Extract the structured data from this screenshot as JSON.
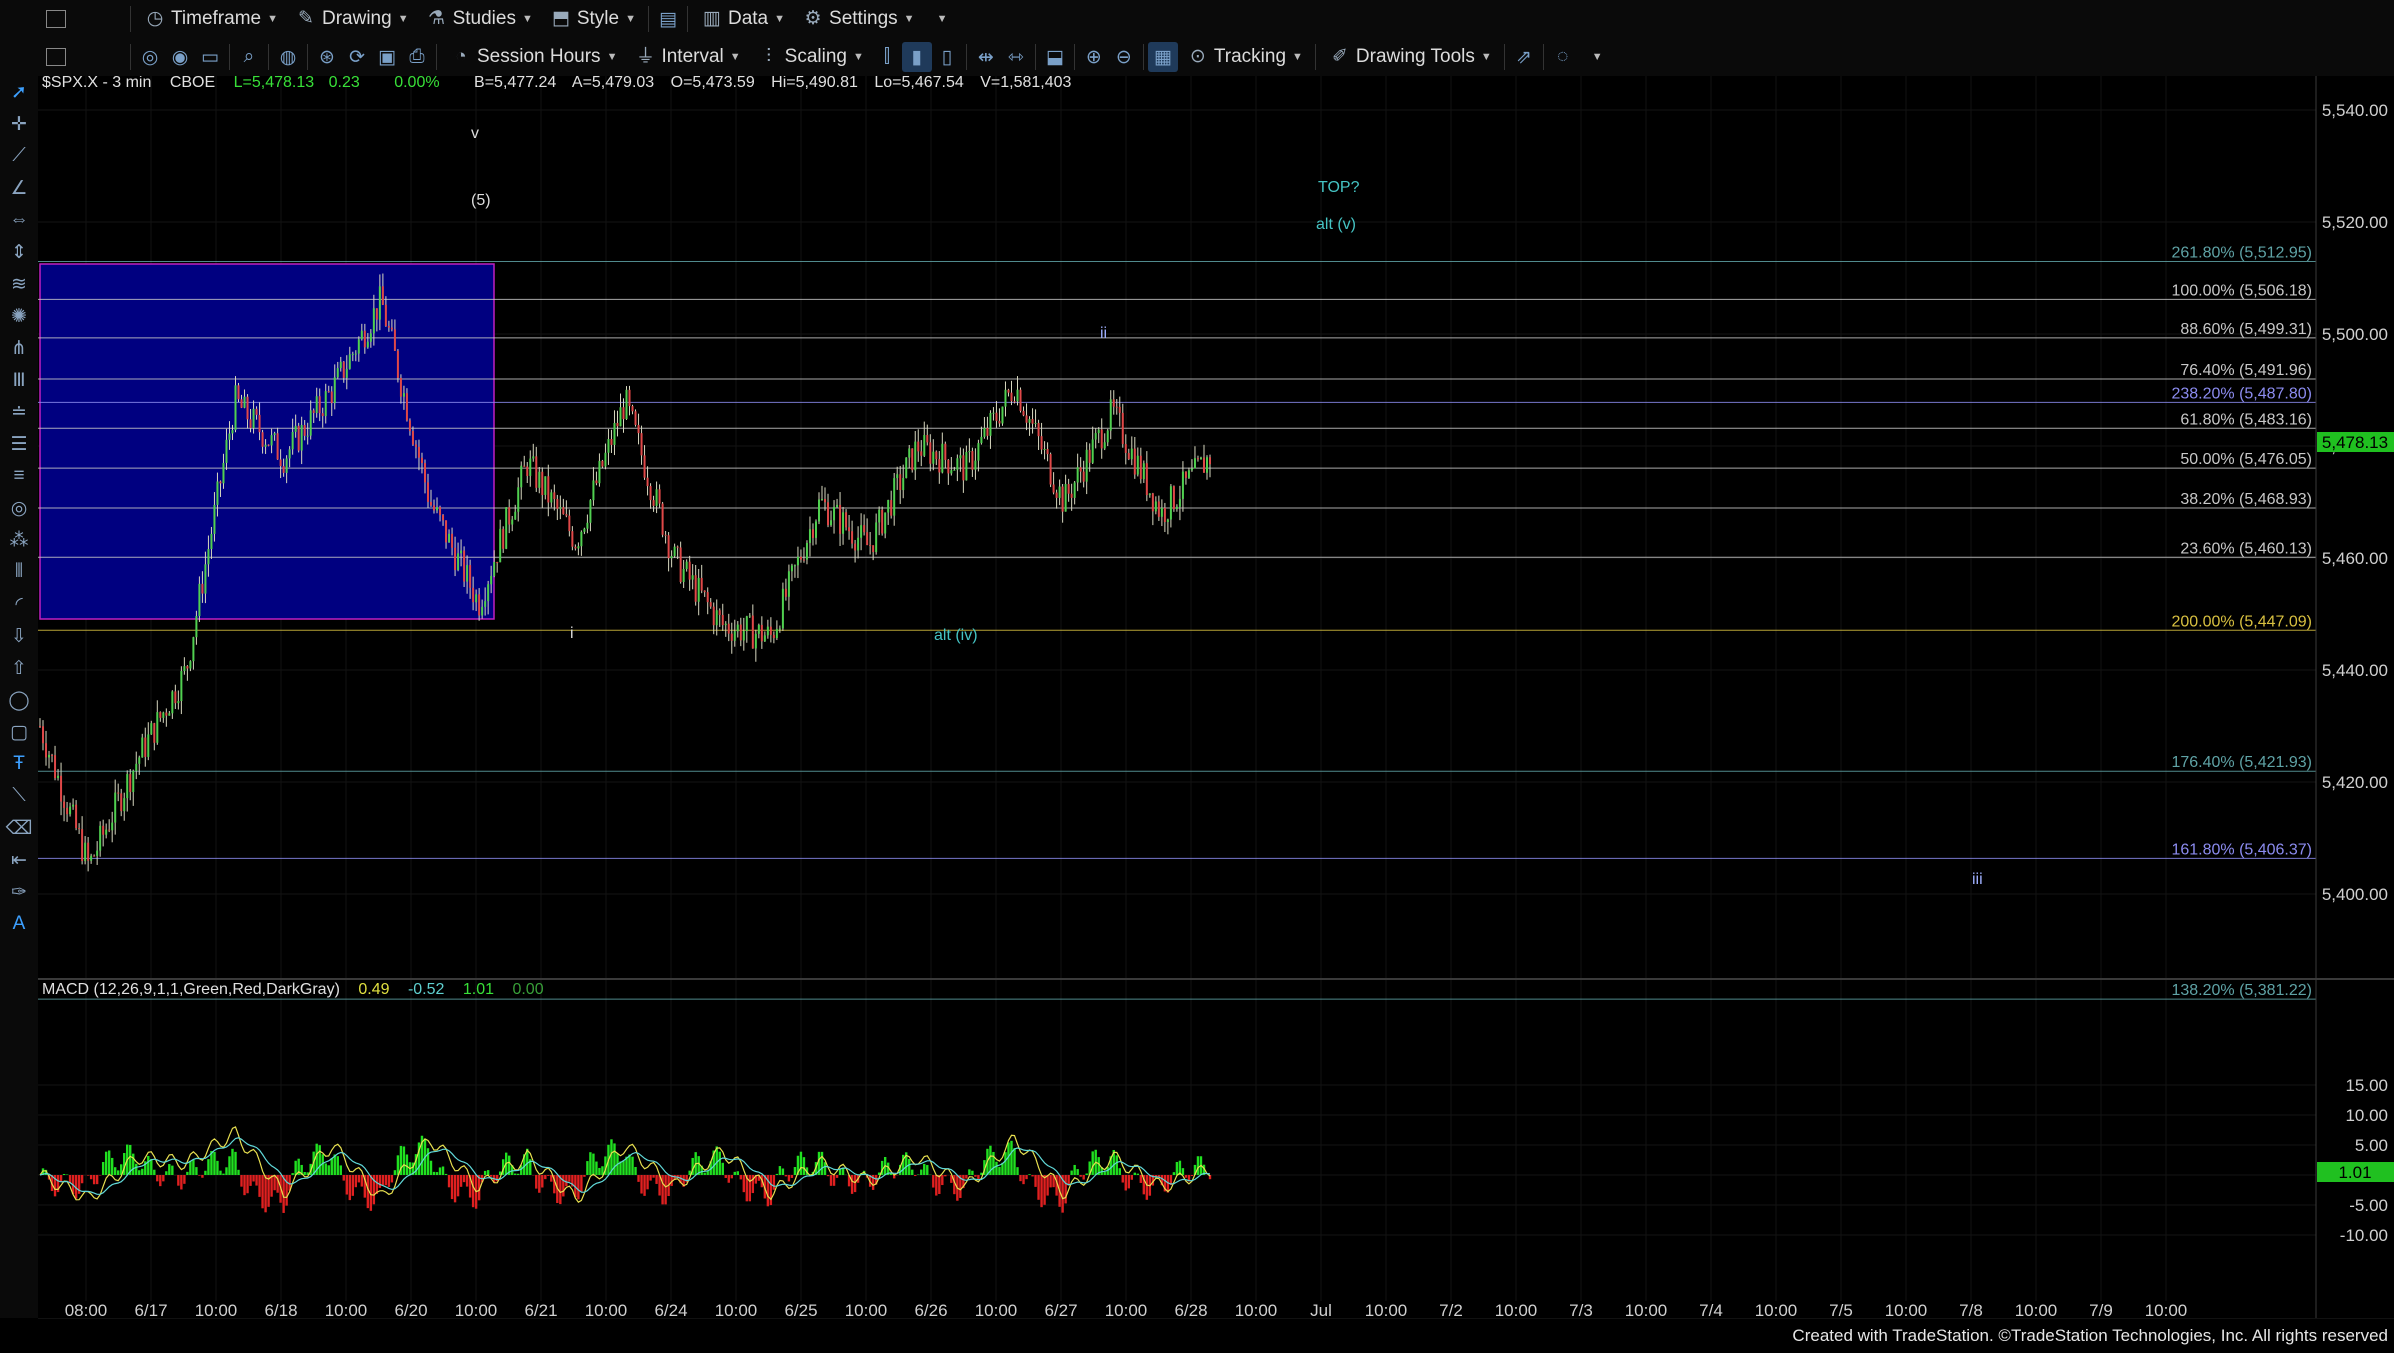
{
  "toolbar_top": {
    "items": [
      {
        "label": "Timeframe",
        "icon": "clock-icon"
      },
      {
        "label": "Drawing",
        "icon": "pencil-icon"
      },
      {
        "label": "Studies",
        "icon": "studies-icon"
      },
      {
        "label": "Style",
        "icon": "style-icon"
      },
      {
        "label": "Data",
        "icon": "data-bars-icon"
      },
      {
        "label": "Settings",
        "icon": "gear-icon"
      }
    ]
  },
  "toolbar_second": {
    "session_hours": "Session Hours",
    "interval": "Interval",
    "scaling": "Scaling",
    "tracking": "Tracking",
    "drawing_tools": "Drawing Tools"
  },
  "symbol_bar": {
    "symbol": "$SPX.X - 3 min",
    "exchange": "CBOE",
    "last": "L=5,478.13",
    "change": "0.23",
    "pct": "0.00%",
    "bid": "B=5,477.24",
    "ask": "A=5,479.03",
    "open": "O=5,473.59",
    "high": "Hi=5,490.81",
    "low": "Lo=5,467.54",
    "volume": "V=1,581,403"
  },
  "macd_bar": {
    "title": "MACD (12,26,9,1,1,Green,Red,DarkGray)",
    "v1": "0.49",
    "v2": "-0.52",
    "v3": "1.01",
    "v4": "0.00"
  },
  "price_axis": [
    "5,540.00",
    "5,520.00",
    "5,500.00",
    "5,480.00",
    "5,460.00",
    "5,440.00",
    "5,420.00",
    "5,400.00"
  ],
  "macd_axis": [
    "15.00",
    "10.00",
    "5.00",
    "0.00",
    "-5.00",
    "-10.00"
  ],
  "current_price_tag": "5,478.13",
  "current_macd_tag": "1.01",
  "time_axis": [
    "08:00",
    "6/17",
    "10:00",
    "6/18",
    "10:00",
    "6/20",
    "10:00",
    "6/21",
    "10:00",
    "6/24",
    "10:00",
    "6/25",
    "10:00",
    "6/26",
    "10:00",
    "6/27",
    "10:00",
    "6/28",
    "10:00",
    "Jul",
    "10:00",
    "7/2",
    "10:00",
    "7/3",
    "10:00",
    "7/4",
    "10:00",
    "7/5",
    "10:00",
    "7/8",
    "10:00",
    "7/9",
    "10:00"
  ],
  "fib_levels": [
    {
      "label": "261.80% (5,512.95)",
      "price": 5512.95,
      "color": "#5fa3a6"
    },
    {
      "label": "100.00% (5,506.18)",
      "price": 5506.18,
      "color": "#c8c8c8"
    },
    {
      "label": "88.60% (5,499.31)",
      "price": 5499.31,
      "color": "#c8c8c8"
    },
    {
      "label": "76.40% (5,491.96)",
      "price": 5491.96,
      "color": "#c8c8c8"
    },
    {
      "label": "238.20% (5,487.80)",
      "price": 5487.8,
      "color": "#8c8cf0"
    },
    {
      "label": "61.80% (5,483.16)",
      "price": 5483.16,
      "color": "#c8c8c8"
    },
    {
      "label": "50.00% (5,476.05)",
      "price": 5476.05,
      "color": "#c8c8c8"
    },
    {
      "label": "38.20% (5,468.93)",
      "price": 5468.93,
      "color": "#c8c8c8"
    },
    {
      "label": "23.60% (5,460.13)",
      "price": 5460.13,
      "color": "#c8c8c8"
    },
    {
      "label": "200.00% (5,447.09)",
      "price": 5447.09,
      "color": "#d8c040"
    },
    {
      "label": "176.40% (5,421.93)",
      "price": 5421.93,
      "color": "#5fa3a6"
    },
    {
      "label": "161.80% (5,406.37)",
      "price": 5406.37,
      "color": "#8c8cf0"
    },
    {
      "label": "138.20% (5,381.22)",
      "price": 5381.22,
      "color": "#5fa3a6"
    }
  ],
  "wave_labels": [
    {
      "text": "v",
      "color": "#dddddd"
    },
    {
      "text": "(5)",
      "color": "#dddddd"
    },
    {
      "text": "TOP?",
      "color": "#45c4c4"
    },
    {
      "text": "alt (v)",
      "color": "#45c4c4"
    },
    {
      "text": "ii",
      "color": "#9fb0ff"
    },
    {
      "text": "i",
      "color": "#dddddd"
    },
    {
      "text": "alt (iv)",
      "color": "#45c4c4"
    },
    {
      "text": "iii",
      "color": "#9fb0ff"
    }
  ],
  "chart_data": {
    "type": "line",
    "title": "$SPX.X - 3 min",
    "ylim": [
      5378,
      5545
    ],
    "x": [
      "6/17 08:00",
      "6/17 10:00",
      "6/18 10:00",
      "6/20 10:00",
      "6/21 10:00",
      "6/24 10:00",
      "6/25 10:00",
      "6/26 10:00",
      "6/27 10:00"
    ],
    "price_path": [
      5430,
      5405,
      5424,
      5440,
      5488,
      5478,
      5490,
      5506,
      5470,
      5452,
      5477,
      5463,
      5488,
      5460,
      5448,
      5446,
      5470,
      5462,
      5480,
      5476,
      5491,
      5470,
      5486,
      5468,
      5478.13
    ],
    "macd_path": [
      0,
      -4,
      3,
      2,
      7,
      -3,
      5,
      -4,
      6,
      -2,
      3,
      -4,
      5,
      -2,
      4,
      -3,
      2,
      -1,
      3,
      -2,
      6,
      -3,
      3,
      -2,
      1
    ]
  },
  "footer": "Created with TradeStation. ©TradeStation Technologies, Inc. All rights reserved"
}
